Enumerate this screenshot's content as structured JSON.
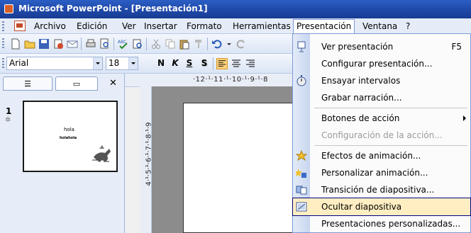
{
  "window": {
    "title": "Microsoft PowerPoint - [Presentación1]"
  },
  "menubar": {
    "items": [
      "Archivo",
      "Edición",
      "Ver",
      "Insertar",
      "Formato",
      "Herramientas",
      "Presentación",
      "Ventana",
      "?"
    ],
    "active": "Presentación"
  },
  "toolbar_format": {
    "font": "Arial",
    "size": "18",
    "bold": "N",
    "italic": "K",
    "underline": "S",
    "shadow": "S"
  },
  "slides_panel": {
    "slide_number": "1",
    "thumbnail": {
      "title": "hola",
      "subtitle": "holahola"
    }
  },
  "ruler": {
    "horizontal": "·12·¹·11·¹·10·¹·9·¹·8",
    "vertical": "4·¹·5·¹·6·¹·7·¹·8·¹·9"
  },
  "dropdown": {
    "items": [
      {
        "label": "Ver presentación",
        "shortcut": "F5",
        "icon": "projector-icon"
      },
      {
        "label": "Configurar presentación...",
        "icon": ""
      },
      {
        "label": "Ensayar intervalos",
        "icon": "stopwatch-icon"
      },
      {
        "label": "Grabar narración...",
        "icon": ""
      },
      {
        "label": "Botones de acción",
        "submenu": true,
        "icon": ""
      },
      {
        "label": "Configuración de la acción...",
        "disabled": true,
        "icon": ""
      },
      {
        "label": "Efectos de animación...",
        "icon": "star-effects-icon"
      },
      {
        "label": "Personalizar animación...",
        "icon": "custom-animation-icon"
      },
      {
        "label": "Transición de diapositiva...",
        "icon": "transition-icon"
      },
      {
        "label": "Ocultar diapositiva",
        "highlighted": true,
        "icon": "hide-slide-icon"
      },
      {
        "label": "Presentaciones personalizadas...",
        "icon": ""
      }
    ]
  },
  "colors": {
    "titlebar": "#1f48a8",
    "menu_highlight": "#ffeec2",
    "accent_border": "#000080"
  }
}
